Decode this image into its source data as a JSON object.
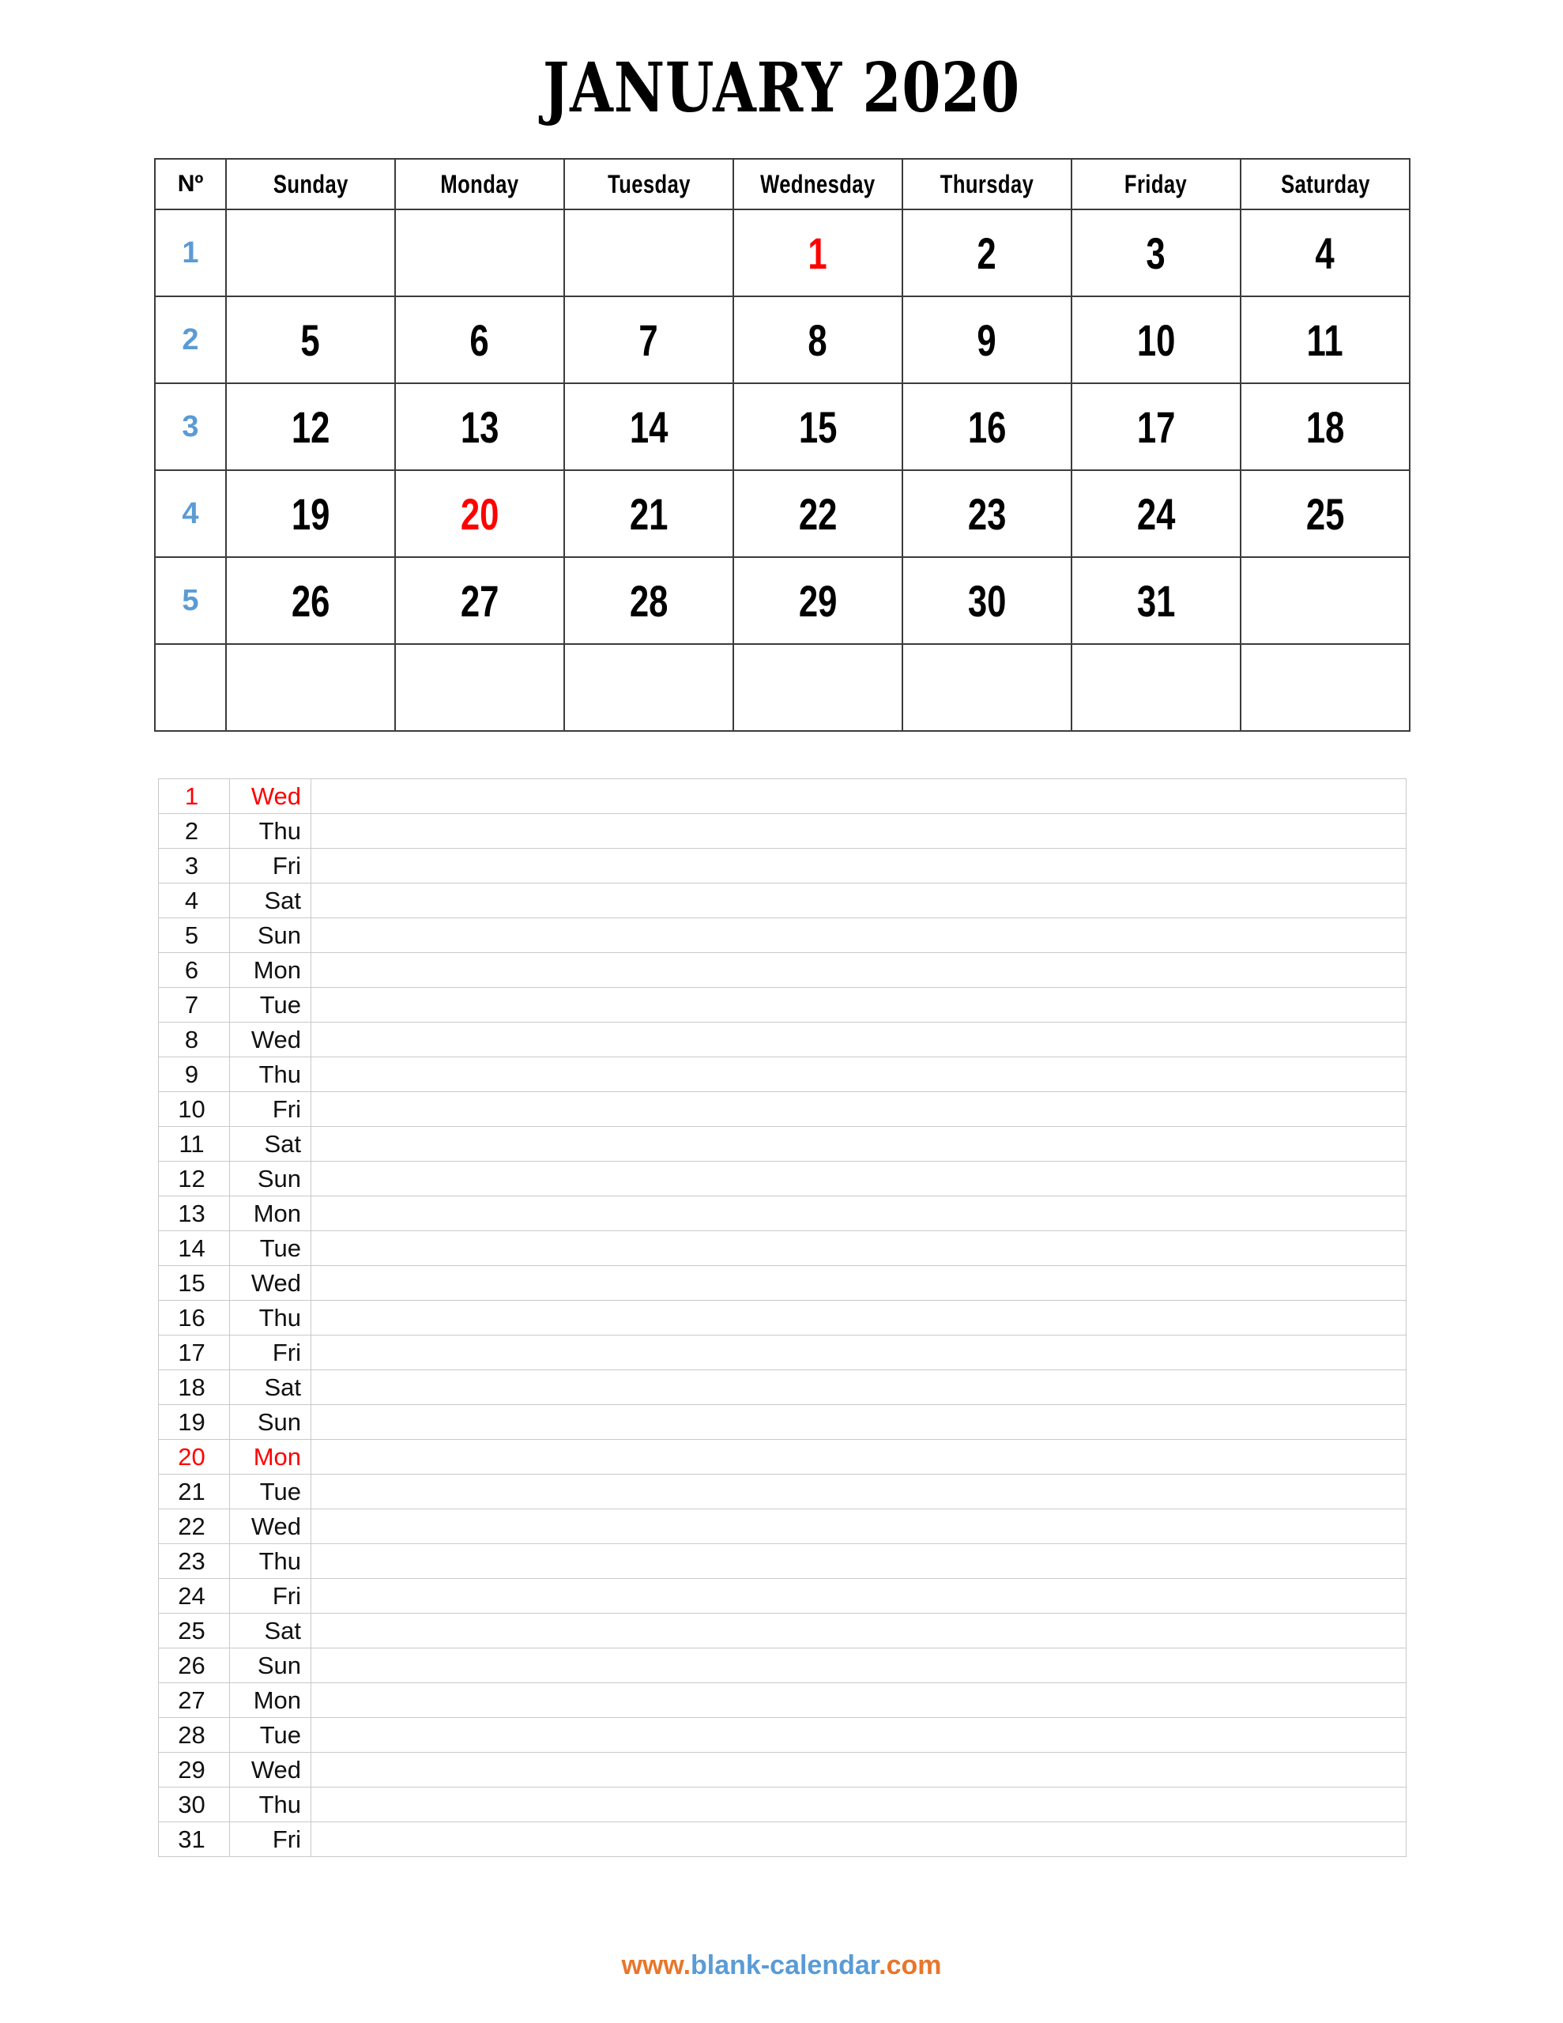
{
  "document": {
    "title": "JANUARY 2020",
    "month": "JANUARY",
    "year": "2020"
  },
  "colors": {
    "holiday_red": "#FF0000",
    "week_number_blue": "#5B9BD5",
    "footer_orange": "#E8762C",
    "footer_blue": "#5B9BD5",
    "grid_border": "#3b3b3b",
    "list_border": "#c9c9c9"
  },
  "month_grid": {
    "headers": [
      "Nº",
      "Sunday",
      "Monday",
      "Tuesday",
      "Wednesday",
      "Thursday",
      "Friday",
      "Saturday"
    ],
    "rows": [
      {
        "week": "1",
        "days": [
          "",
          "",
          "",
          "1",
          "2",
          "3",
          "4"
        ],
        "holidays": [
          3
        ]
      },
      {
        "week": "2",
        "days": [
          "5",
          "6",
          "7",
          "8",
          "9",
          "10",
          "11"
        ],
        "holidays": []
      },
      {
        "week": "3",
        "days": [
          "12",
          "13",
          "14",
          "15",
          "16",
          "17",
          "18"
        ],
        "holidays": []
      },
      {
        "week": "4",
        "days": [
          "19",
          "20",
          "21",
          "22",
          "23",
          "24",
          "25"
        ],
        "holidays": [
          1
        ]
      },
      {
        "week": "5",
        "days": [
          "26",
          "27",
          "28",
          "29",
          "30",
          "31",
          ""
        ],
        "holidays": []
      },
      {
        "week": "",
        "days": [
          "",
          "",
          "",
          "",
          "",
          "",
          ""
        ],
        "holidays": []
      }
    ]
  },
  "day_list": {
    "rows": [
      {
        "num": "1",
        "abbr": "Wed",
        "note": "",
        "holiday": true
      },
      {
        "num": "2",
        "abbr": "Thu",
        "note": "",
        "holiday": false
      },
      {
        "num": "3",
        "abbr": "Fri",
        "note": "",
        "holiday": false
      },
      {
        "num": "4",
        "abbr": "Sat",
        "note": "",
        "holiday": false
      },
      {
        "num": "5",
        "abbr": "Sun",
        "note": "",
        "holiday": false
      },
      {
        "num": "6",
        "abbr": "Mon",
        "note": "",
        "holiday": false
      },
      {
        "num": "7",
        "abbr": "Tue",
        "note": "",
        "holiday": false
      },
      {
        "num": "8",
        "abbr": "Wed",
        "note": "",
        "holiday": false
      },
      {
        "num": "9",
        "abbr": "Thu",
        "note": "",
        "holiday": false
      },
      {
        "num": "10",
        "abbr": "Fri",
        "note": "",
        "holiday": false
      },
      {
        "num": "11",
        "abbr": "Sat",
        "note": "",
        "holiday": false
      },
      {
        "num": "12",
        "abbr": "Sun",
        "note": "",
        "holiday": false
      },
      {
        "num": "13",
        "abbr": "Mon",
        "note": "",
        "holiday": false
      },
      {
        "num": "14",
        "abbr": "Tue",
        "note": "",
        "holiday": false
      },
      {
        "num": "15",
        "abbr": "Wed",
        "note": "",
        "holiday": false
      },
      {
        "num": "16",
        "abbr": "Thu",
        "note": "",
        "holiday": false
      },
      {
        "num": "17",
        "abbr": "Fri",
        "note": "",
        "holiday": false
      },
      {
        "num": "18",
        "abbr": "Sat",
        "note": "",
        "holiday": false
      },
      {
        "num": "19",
        "abbr": "Sun",
        "note": "",
        "holiday": false
      },
      {
        "num": "20",
        "abbr": "Mon",
        "note": "",
        "holiday": true
      },
      {
        "num": "21",
        "abbr": "Tue",
        "note": "",
        "holiday": false
      },
      {
        "num": "22",
        "abbr": "Wed",
        "note": "",
        "holiday": false
      },
      {
        "num": "23",
        "abbr": "Thu",
        "note": "",
        "holiday": false
      },
      {
        "num": "24",
        "abbr": "Fri",
        "note": "",
        "holiday": false
      },
      {
        "num": "25",
        "abbr": "Sat",
        "note": "",
        "holiday": false
      },
      {
        "num": "26",
        "abbr": "Sun",
        "note": "",
        "holiday": false
      },
      {
        "num": "27",
        "abbr": "Mon",
        "note": "",
        "holiday": false
      },
      {
        "num": "28",
        "abbr": "Tue",
        "note": "",
        "holiday": false
      },
      {
        "num": "29",
        "abbr": "Wed",
        "note": "",
        "holiday": false
      },
      {
        "num": "30",
        "abbr": "Thu",
        "note": "",
        "holiday": false
      },
      {
        "num": "31",
        "abbr": "Fri",
        "note": "",
        "holiday": false
      }
    ]
  },
  "footer": {
    "full_text": "www.blank-calendar.com",
    "segment_prefix": "www.",
    "segment_name": "blank-calendar",
    "segment_tld": ".com"
  }
}
